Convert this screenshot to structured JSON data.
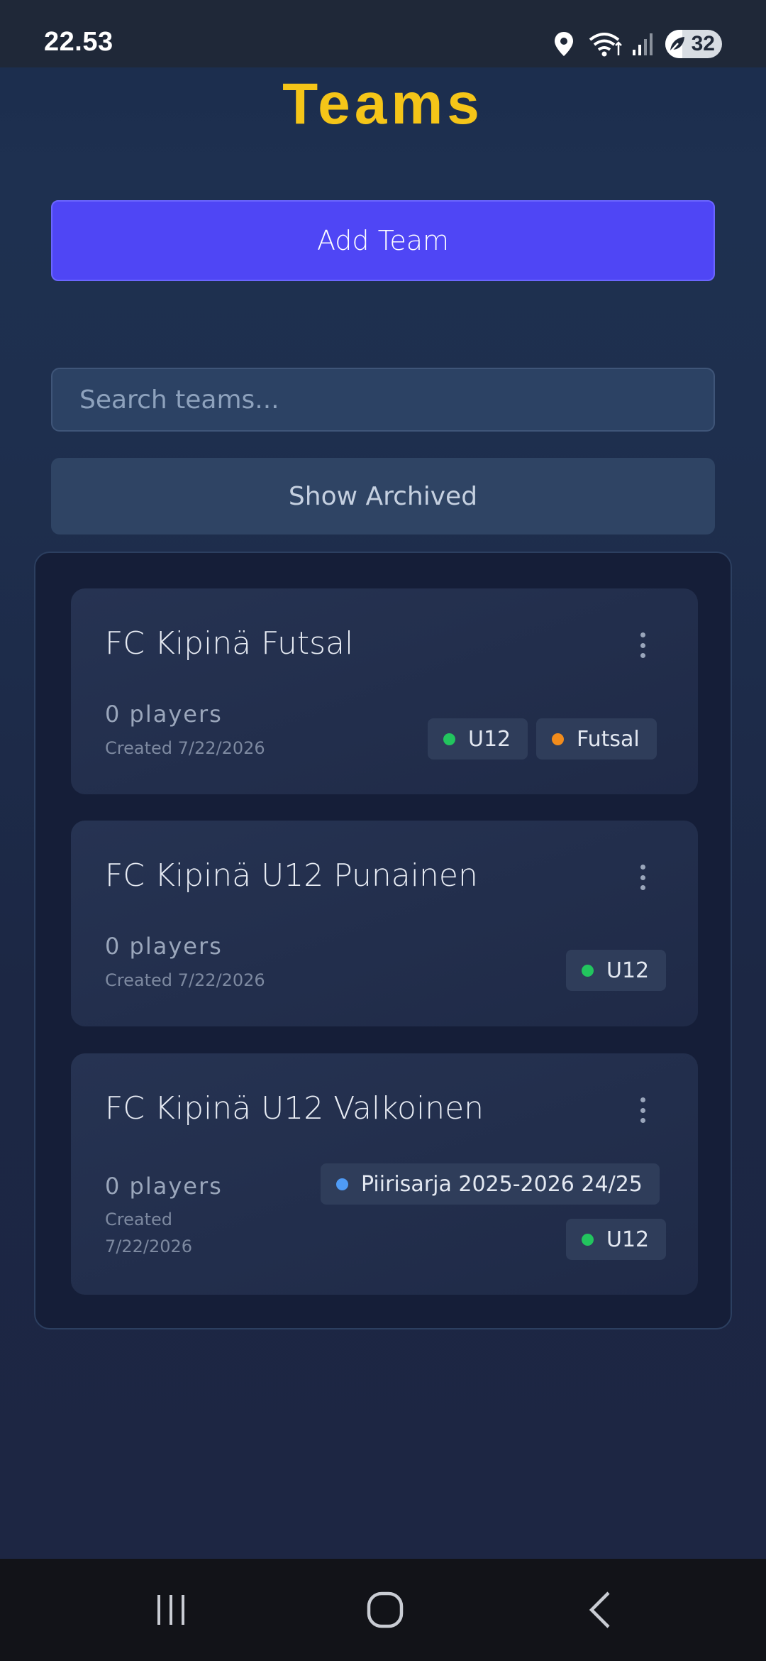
{
  "status_bar": {
    "time": "22.53",
    "battery": "32",
    "icons": [
      "location-icon",
      "wifi-icon",
      "signal-icon",
      "battery-icon"
    ]
  },
  "header": {
    "title": "Teams"
  },
  "actions": {
    "add_team_label": "Add Team",
    "search_placeholder": "Search teams...",
    "show_archived_label": "Show Archived"
  },
  "teams": [
    {
      "name": "FC Kipinä Futsal",
      "players": "0 players",
      "created": "Created 7/22/2026",
      "tags": [
        {
          "label": "U12",
          "color": "#22c55e"
        },
        {
          "label": "Futsal",
          "color": "#f28c1c"
        }
      ]
    },
    {
      "name": "FC Kipinä U12 Punainen",
      "players": "0 players",
      "created": "Created 7/22/2026",
      "tags": [
        {
          "label": "U12",
          "color": "#22c55e"
        }
      ]
    },
    {
      "name": "FC Kipinä U12 Valkoinen",
      "players": "0 players",
      "created_line1": "Created",
      "created_line2": "7/22/2026",
      "tags": [
        {
          "label": "Piirisarja 2025-2026 24/25",
          "color": "#4f9bf5"
        },
        {
          "label": "U12",
          "color": "#22c55e"
        }
      ]
    }
  ],
  "colors": {
    "accent": "#4f46f5",
    "title": "#f5c518",
    "background": "#1d2742"
  },
  "nav": {
    "buttons": [
      "recent-apps-icon",
      "home-icon",
      "back-icon"
    ]
  }
}
